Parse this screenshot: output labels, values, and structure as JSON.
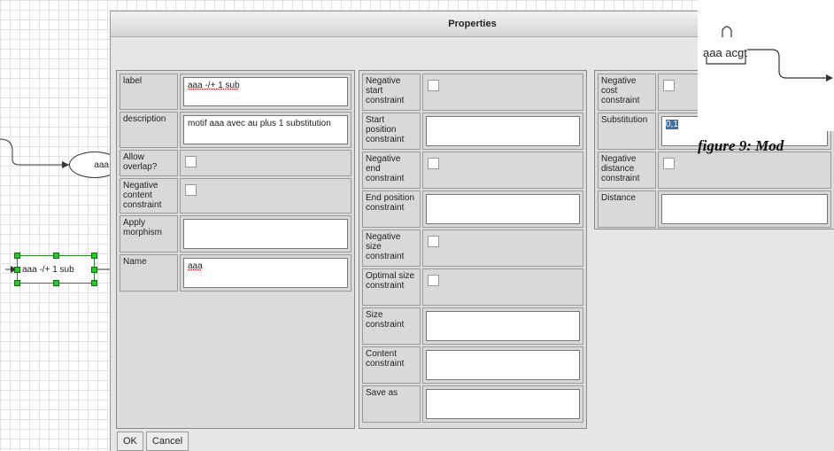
{
  "window": {
    "title": "Properties"
  },
  "background": {
    "ellipse_label": "aaa",
    "selected_node_label": "aaa -/+ 1 sub"
  },
  "figure": {
    "node_text": "aaa acgt",
    "caption": "figure 9: Mod"
  },
  "panel1": {
    "label": {
      "name": "label",
      "value": "aaa -/+ 1 sub"
    },
    "description": {
      "name": "description",
      "value": "motif aaa avec au plus 1 substitution"
    },
    "allow_overlap": {
      "name": "Allow overlap?",
      "checked": false
    },
    "negative_content": {
      "name": "Negative content constraint",
      "checked": false
    },
    "apply_morphism": {
      "name": "Apply morphism",
      "value": ""
    },
    "name_field": {
      "name": "Name",
      "value": "aaa"
    }
  },
  "panel2": {
    "negative_start": {
      "name": "Negative start constraint",
      "checked": false
    },
    "start_position": {
      "name": "Start position constraint",
      "value": ""
    },
    "negative_end": {
      "name": "Negative end constraint",
      "checked": false
    },
    "end_position": {
      "name": "End position constraint",
      "value": ""
    },
    "negative_size": {
      "name": "Negative size constraint",
      "checked": false
    },
    "optimal_size": {
      "name": "Optimal size constraint",
      "checked": false
    },
    "size_constraint": {
      "name": "Size constraint",
      "value": ""
    },
    "content_constraint": {
      "name": "Content constraint",
      "value": ""
    },
    "save_as": {
      "name": "Save as",
      "value": ""
    }
  },
  "panel3": {
    "negative_cost": {
      "name": "Negative cost constraint",
      "checked": false
    },
    "substitution": {
      "name": "Substitution",
      "value": "0,1"
    },
    "negative_distance": {
      "name": "Negative distance constraint",
      "checked": false
    },
    "distance": {
      "name": "Distance",
      "value": ""
    }
  },
  "buttons": {
    "ok": "OK",
    "cancel": "Cancel"
  }
}
